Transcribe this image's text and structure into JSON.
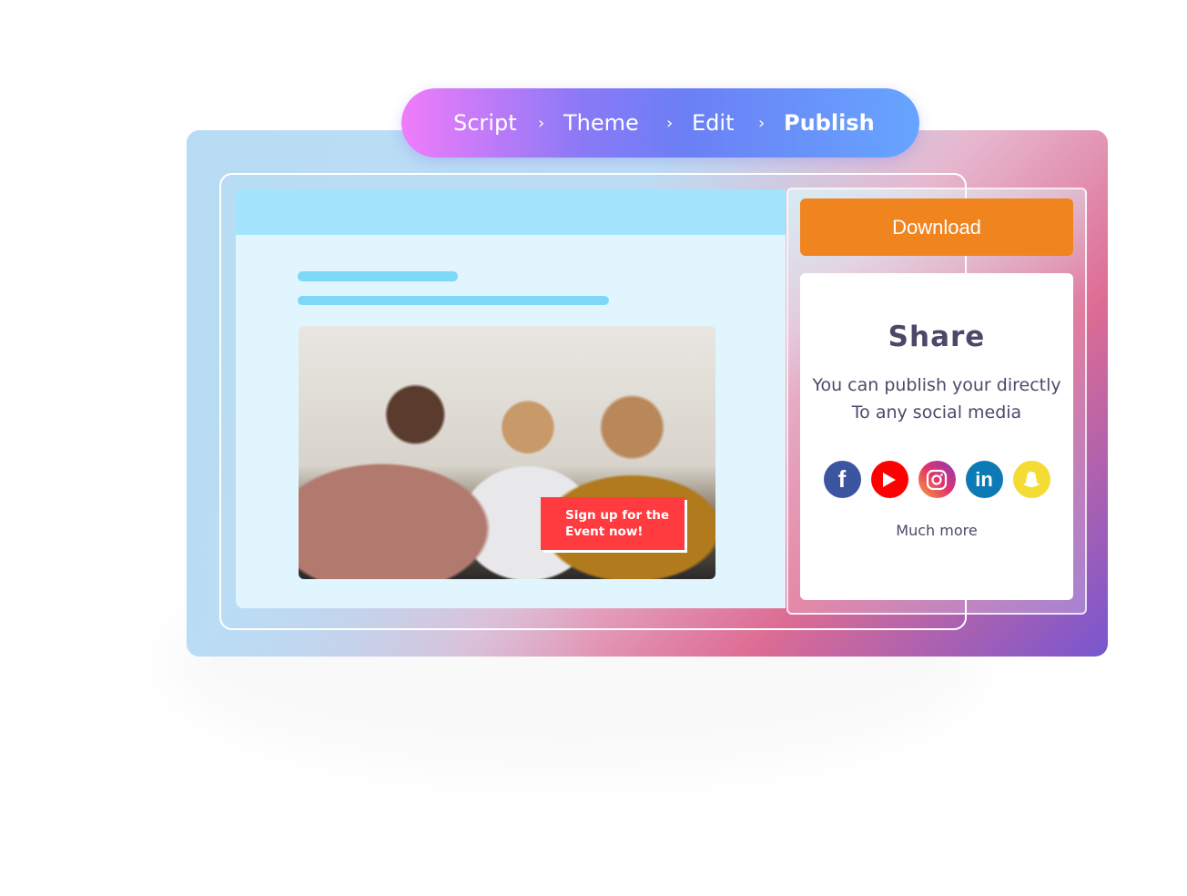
{
  "steps": {
    "items": [
      "Script",
      "Theme",
      "Edit",
      "Publish"
    ],
    "active": "Publish",
    "separator": "›"
  },
  "preview": {
    "cta_text": "Sign up for the\nEvent now!",
    "cta_color": "#ff3b3f"
  },
  "download": {
    "label": "Download",
    "color": "#f0841f"
  },
  "share": {
    "title": "Share",
    "description": "You can publish your directly\nTo any social media",
    "more_label": "Much more",
    "icons": [
      "facebook-icon",
      "youtube-icon",
      "instagram-icon",
      "linkedin-icon",
      "snapchat-icon"
    ]
  }
}
